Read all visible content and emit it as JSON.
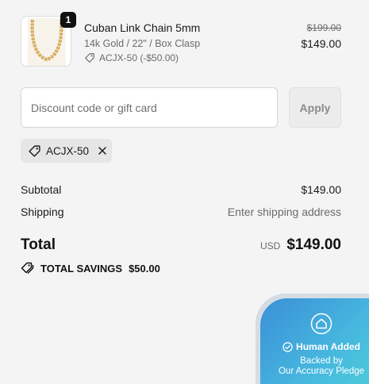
{
  "line_item": {
    "quantity": "1",
    "name": "Cuban Link Chain 5mm",
    "variant": "14k Gold / 22\" / Box Clasp",
    "discount": "ACJX-50 (-$50.00)",
    "original_price": "$199.00",
    "price": "$149.00",
    "thumbnail_icon": "gold-chain-image"
  },
  "discount_form": {
    "placeholder": "Discount code or gift card",
    "value": "",
    "apply_label": "Apply"
  },
  "applied_code": {
    "label": "ACJX-50"
  },
  "summary": {
    "subtotal_label": "Subtotal",
    "subtotal_value": "$149.00",
    "shipping_label": "Shipping",
    "shipping_value": "Enter shipping address",
    "total_label": "Total",
    "currency": "USD",
    "total_value": "$149.00",
    "savings_label": "TOTAL SAVINGS",
    "savings_value": "$50.00"
  },
  "badge": {
    "title": "Human Added",
    "line1": "Backed by",
    "line2": "Our Accuracy Pledge",
    "icon": "shield-house-icon"
  },
  "colors": {
    "background": "#f4f4f4",
    "badge_gradient_start": "#3b8fd6",
    "badge_gradient_end": "#4fd0d9",
    "chip_background": "#e6e6e6"
  }
}
